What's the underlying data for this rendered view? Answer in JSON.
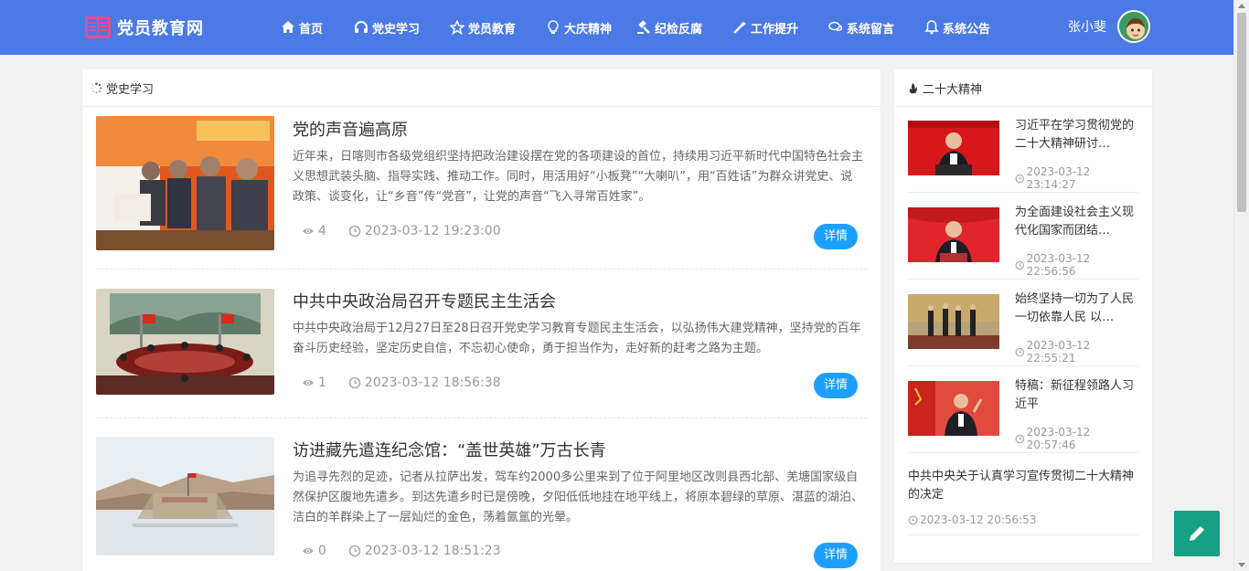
{
  "header": {
    "logo_text": "党员教育网",
    "nav": [
      {
        "label": "首页",
        "icon": "home-icon"
      },
      {
        "label": "党史学习",
        "icon": "headphones-icon"
      },
      {
        "label": "党员教育",
        "icon": "star-icon"
      },
      {
        "label": "大庆精神",
        "icon": "lightbulb-icon"
      },
      {
        "label": "纪检反腐",
        "icon": "gavel-icon"
      },
      {
        "label": "工作提升",
        "icon": "magic-wand-icon"
      },
      {
        "label": "系统留言",
        "icon": "comments-icon"
      },
      {
        "label": "系统公告",
        "icon": "bell-icon"
      }
    ],
    "user_name": "张小斐"
  },
  "main": {
    "section_title": "党史学习",
    "articles": [
      {
        "title": "党的声音遍高原",
        "desc": "近年来，日喀则市各级党组织坚持把政治建设摆在党的各项建设的首位，持续用习近平新时代中国特色社会主义思想武装头脑、指导实践、推动工作。同时，用活用好“小板凳”“大喇叭”，用“百姓话”为群众讲党史、说政策、谈变化，让“乡音”传“党音”，让党的声音“飞入寻常百姓家”。",
        "views": "4",
        "time": "2023-03-12 19:23:00",
        "button": "详情"
      },
      {
        "title": "中共中央政治局召开专题民主生活会",
        "desc": "中共中央政治局于12月27日至28日召开党史学习教育专题民主生活会，以弘扬伟大建党精神，坚持党的百年奋斗历史经验，坚定历史自信，不忘初心使命，勇于担当作为，走好新的赶考之路为主题。",
        "views": "1",
        "time": "2023-03-12 18:56:38",
        "button": "详情"
      },
      {
        "title": "访进藏先遣连纪念馆：“盖世英雄”万古长青",
        "desc": "为追寻先烈的足迹，记者从拉萨出发，驾车约2000多公里来到了位于阿里地区改则县西北部、羌塘国家级自然保护区腹地先遣乡。到达先遣乡时已是傍晚，夕阳低低地挂在地平线上，将原本碧绿的草原、湛蓝的湖泊、洁白的羊群染上了一层灿烂的金色，荡着氤氲的光晕。",
        "views": "0",
        "time": "2023-03-12 18:51:23",
        "button": "详情"
      }
    ]
  },
  "side": {
    "section_title": "二十大精神",
    "items": [
      {
        "title": "习近平在学习贯彻党的二十大精神研讨…",
        "date": "2023-03-12 23:14:27"
      },
      {
        "title": "为全面建设社会主义现代化国家而团结…",
        "date": "2023-03-12 22:56:56"
      },
      {
        "title": "始终坚持一切为了人民一切依靠人民 以…",
        "date": "2023-03-12 22:55:21"
      },
      {
        "title": "特稿：新征程领路人习近平",
        "date": "2023-03-12 20:57:46"
      },
      {
        "title": "中共中央关于认真学习宣传贯彻二十大精神的决定",
        "date": "2023-03-12 20:56:53"
      }
    ]
  },
  "colors": {
    "header_bg": "#4b7ae6",
    "accent_button": "#1e9fff",
    "fab_bg": "#16a085"
  }
}
